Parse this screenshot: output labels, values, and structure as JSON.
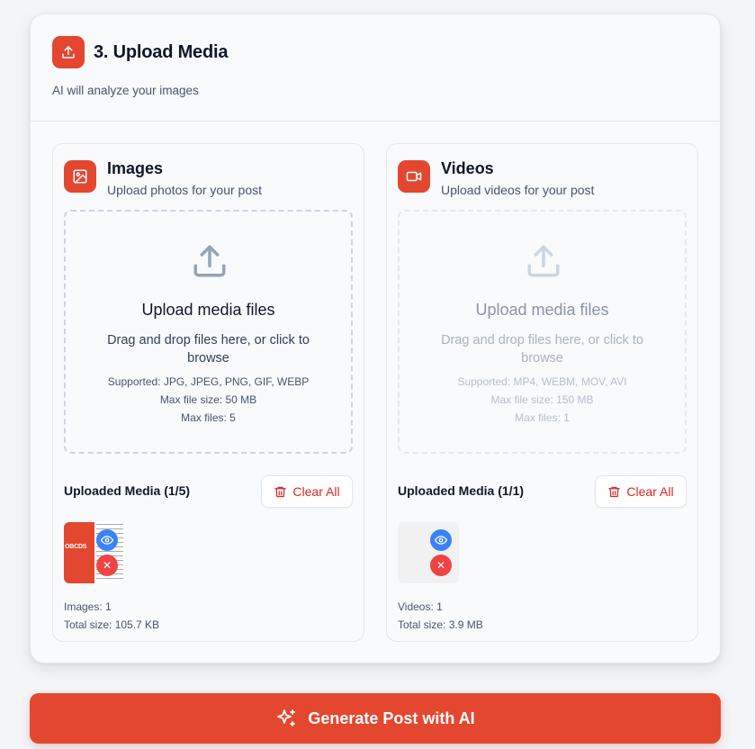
{
  "section": {
    "title": "3. Upload Media",
    "subtitle": "AI will analyze your images"
  },
  "images": {
    "title": "Images",
    "subtitle": "Upload photos for your post",
    "drop_title": "Upload media files",
    "drop_desc": "Drag and drop files here, or click to browse",
    "supported": "Supported: JPG, JPEG, PNG, GIF, WEBP",
    "max_size": "Max file size: 50 MB",
    "max_files": "Max files: 5",
    "uploaded_label": "Uploaded Media (1/5)",
    "clear_label": "Clear All",
    "thumb_text": "OBCDS",
    "count_text": "Images: 1",
    "size_text": "Total size: 105.7 KB"
  },
  "videos": {
    "title": "Videos",
    "subtitle": "Upload videos for your post",
    "drop_title": "Upload media files",
    "drop_desc": "Drag and drop files here, or click to browse",
    "supported": "Supported: MP4, WEBM, MOV, AVI",
    "max_size": "Max file size: 150 MB",
    "max_files": "Max files: 1",
    "uploaded_label": "Uploaded Media (1/1)",
    "clear_label": "Clear All",
    "count_text": "Videos: 1",
    "size_text": "Total size: 3.9 MB"
  },
  "generate": {
    "label": "Generate Post with AI"
  },
  "icons": {
    "upload": "upload-icon",
    "image": "image-icon",
    "video": "video-icon",
    "trash": "trash-icon",
    "eye": "eye-icon",
    "close": "close-icon",
    "sparkles": "sparkles-icon"
  },
  "colors": {
    "accent": "#e4472f",
    "danger": "#dc2626",
    "view": "#3b82f6",
    "remove": "#ef4444"
  }
}
